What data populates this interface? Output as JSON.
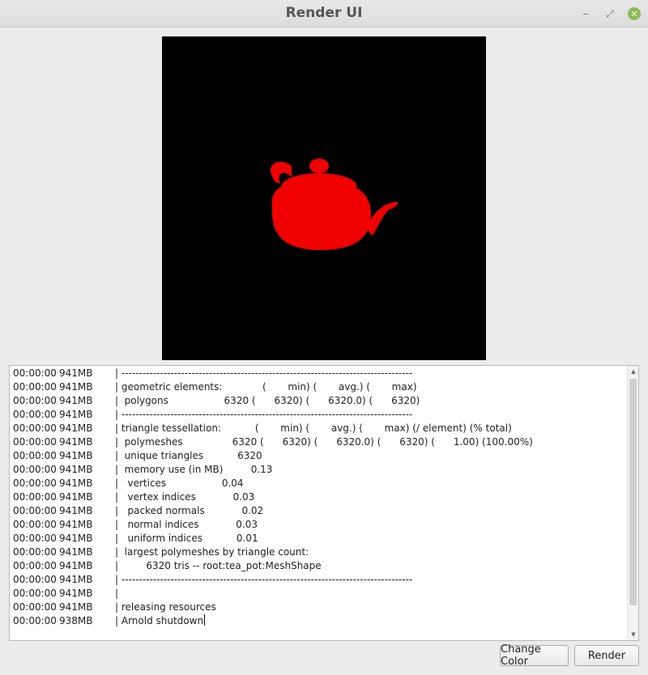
{
  "window": {
    "title": "Render UI",
    "controls": {
      "minimize": "‒",
      "maximize": "⤢",
      "close": "✕"
    }
  },
  "viewport": {
    "background": "#000000",
    "subject": "teapot",
    "color": "#ff0000"
  },
  "log": {
    "lines": [
      {
        "time": "00:00:00",
        "mem": "941MB",
        "text": "| -----------------------------------------------------------------------------------"
      },
      {
        "time": "00:00:00",
        "mem": "941MB",
        "text": "| geometric elements:             (       min) (       avg.) (       max)"
      },
      {
        "time": "00:00:00",
        "mem": "941MB",
        "text": "|  polygons                  6320 (      6320) (      6320.0) (      6320)"
      },
      {
        "time": "00:00:00",
        "mem": "941MB",
        "text": "| -----------------------------------------------------------------------------------"
      },
      {
        "time": "00:00:00",
        "mem": "941MB",
        "text": "| triangle tessellation:           (       min) (       avg.) (       max) (/ element) (% total)"
      },
      {
        "time": "00:00:00",
        "mem": "941MB",
        "text": "|  polymeshes                6320 (      6320) (      6320.0) (      6320) (      1.00) (100.00%)"
      },
      {
        "time": "00:00:00",
        "mem": "941MB",
        "text": "|  unique triangles           6320"
      },
      {
        "time": "00:00:00",
        "mem": "941MB",
        "text": "|  memory use (in MB)         0.13"
      },
      {
        "time": "00:00:00",
        "mem": "941MB",
        "text": "|   vertices                  0.04"
      },
      {
        "time": "00:00:00",
        "mem": "941MB",
        "text": "|   vertex indices            0.03"
      },
      {
        "time": "00:00:00",
        "mem": "941MB",
        "text": "|   packed normals            0.02"
      },
      {
        "time": "00:00:00",
        "mem": "941MB",
        "text": "|   normal indices            0.03"
      },
      {
        "time": "00:00:00",
        "mem": "941MB",
        "text": "|   uniform indices           0.01"
      },
      {
        "time": "00:00:00",
        "mem": "941MB",
        "text": "|  largest polymeshes by triangle count:"
      },
      {
        "time": "00:00:00",
        "mem": "941MB",
        "text": "|         6320 tris -- root:tea_pot:MeshShape"
      },
      {
        "time": "00:00:00",
        "mem": "941MB",
        "text": "| -----------------------------------------------------------------------------------"
      },
      {
        "time": "00:00:00",
        "mem": "941MB",
        "text": "|"
      },
      {
        "time": "00:00:00",
        "mem": "941MB",
        "text": "| releasing resources"
      },
      {
        "time": "00:00:00",
        "mem": "938MB",
        "text": "| Arnold shutdown"
      }
    ]
  },
  "buttons": {
    "change_color": "Change Color",
    "render": "Render"
  }
}
